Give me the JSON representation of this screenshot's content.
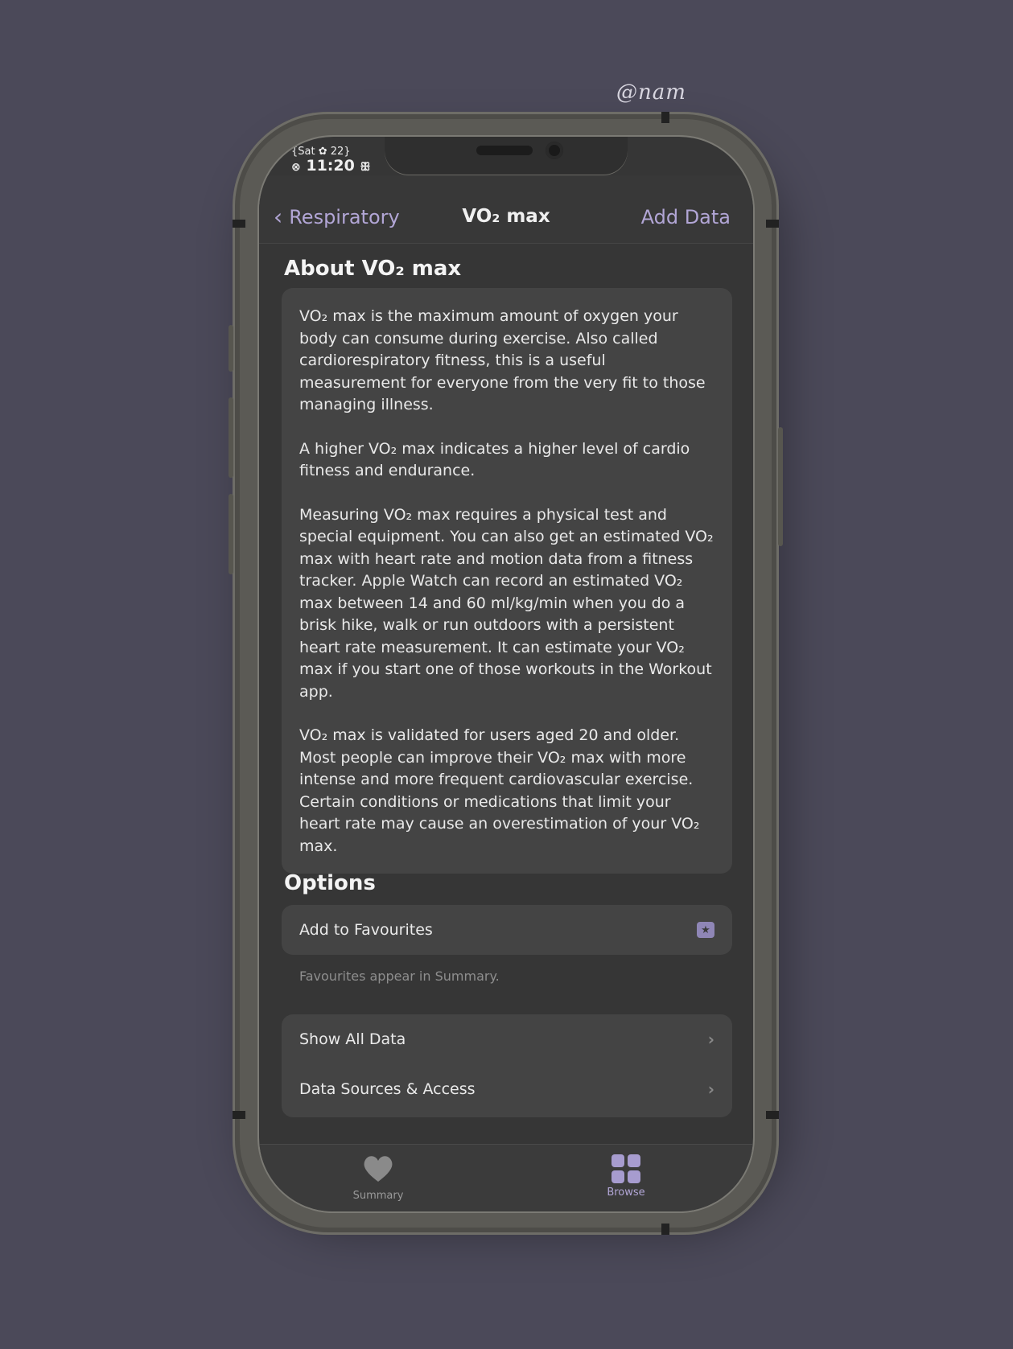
{
  "signature": "@nam",
  "status_bar": {
    "date": "{Sat ✿ 22}",
    "time": "11:20",
    "left_icon": "⊗",
    "right_icon": "ꕥ"
  },
  "nav": {
    "back_label": "Respiratory",
    "title": "VO₂ max",
    "action_label": "Add Data"
  },
  "about": {
    "title": "About VO₂ max",
    "paragraphs": [
      "VO₂ max is the maximum amount of oxygen your body can consume during exercise. Also called cardiorespiratory fitness, this is a useful measurement for everyone from the very fit to those managing illness.",
      "A higher VO₂ max indicates a higher level of cardio fitness and endurance.",
      "Measuring VO₂ max requires a physical test and special equipment. You can also get an estimated VO₂ max with heart rate and motion data from a fitness tracker. Apple Watch can record an estimated VO₂ max between 14 and 60 ml/kg/min when you do a brisk hike, walk or run outdoors with a persistent heart rate measurement. It can estimate your VO₂ max if you start one of those workouts in the Workout app.",
      "VO₂ max is validated for users aged 20 and older. Most people can improve their VO₂ max with more intense and more frequent cardiovascular exercise. Certain conditions or medications that limit your heart rate may cause an overestimation of your VO₂ max."
    ]
  },
  "options": {
    "title": "Options",
    "favourites_label": "Add to Favourites",
    "favourites_note": "Favourites appear in Summary.",
    "rows": [
      "Show All Data",
      "Data Sources & Access"
    ]
  },
  "tabbar": {
    "summary_label": "Summary",
    "browse_label": "Browse"
  },
  "colors": {
    "accent": "#b2a6d6",
    "background": "#4b4959",
    "screen": "#363636",
    "card": "#444444"
  }
}
